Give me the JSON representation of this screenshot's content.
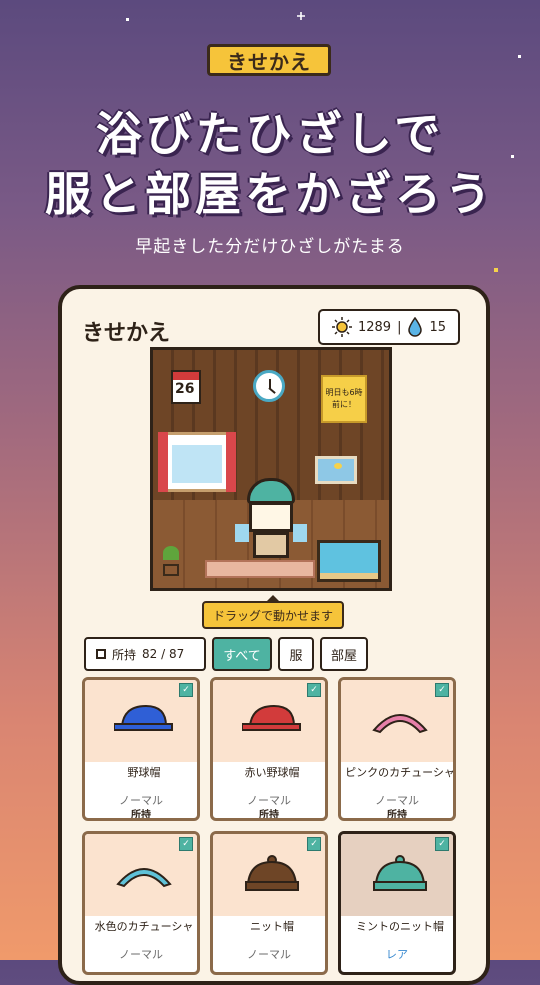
{
  "header": {
    "tag": "きせかえ",
    "headline_line1": "浴びたひざしで",
    "headline_line2": "服と部屋をかざろう",
    "subline": "早起きした分だけひざしがたまる"
  },
  "card": {
    "title": "きせかえ",
    "sun_count": "1289",
    "separator": "|",
    "drop_count": "15",
    "room": {
      "calendar_day": "26",
      "memo_text": "明日も6時前に！"
    },
    "drag_hint": "ドラッグで動かせます",
    "filters": {
      "owned_label": "所持",
      "owned_count": "82 / 87",
      "all": "すべて",
      "clothes": "服",
      "room": "部屋"
    },
    "items": [
      {
        "name": "野球帽",
        "rarity": "ノーマル",
        "status": "所持",
        "color": "#2f5fd6",
        "icon": "cap-icon"
      },
      {
        "name": "赤い野球帽",
        "rarity": "ノーマル",
        "status": "所持",
        "color": "#d23b3b",
        "icon": "cap-icon"
      },
      {
        "name": "ピンクのカチューシャ",
        "rarity": "ノーマル",
        "status": "所持",
        "color": "#e67fa8",
        "icon": "headband-icon"
      },
      {
        "name": "水色のカチューシャ",
        "rarity": "ノーマル",
        "status": "",
        "color": "#5fc2d8",
        "icon": "headband-icon"
      },
      {
        "name": "ニット帽",
        "rarity": "ノーマル",
        "status": "",
        "color": "#6e4526",
        "icon": "knit-hat-icon"
      },
      {
        "name": "ミントのニット帽",
        "rarity": "レア",
        "status": "",
        "color": "#4eb3a2",
        "icon": "knit-hat-icon"
      }
    ]
  }
}
